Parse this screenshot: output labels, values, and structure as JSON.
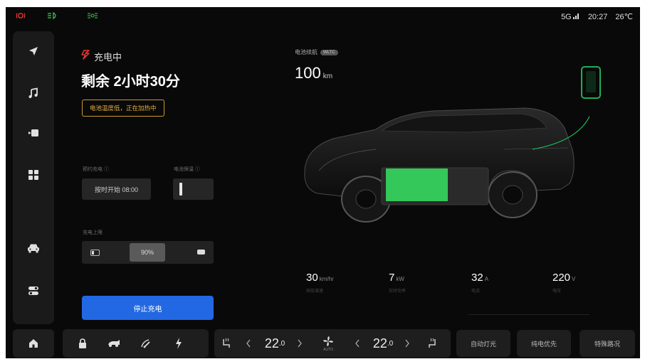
{
  "status_bar": {
    "network": "5G",
    "time": "20:27",
    "temperature": "26℃"
  },
  "sidebar": {
    "items": [
      {
        "icon": "navigation-icon"
      },
      {
        "icon": "music-icon"
      },
      {
        "icon": "camera-icon"
      },
      {
        "icon": "apps-grid-icon"
      },
      {
        "icon": "car-icon"
      },
      {
        "icon": "settings-toggle-icon"
      }
    ]
  },
  "charging": {
    "status": "充电中",
    "remaining": "剩余 2小时30分",
    "warning": "电池温度低，正在加热中",
    "schedule_label": "预约充电 ⓘ",
    "schedule_button": "按时开始 08:00",
    "keepwarm_label": "电池保温 ⓘ",
    "limit_label": "充电上限",
    "limit_value": "90%",
    "stop_button": "停止充电"
  },
  "range": {
    "label": "电池续航",
    "tag": "WLTC",
    "value": "100",
    "unit": "km"
  },
  "stats": [
    {
      "value": "30",
      "unit": "km/hr",
      "sub": "续航增速"
    },
    {
      "value": "7",
      "unit": "kW",
      "sub": "实时功率"
    },
    {
      "value": "32",
      "unit": "A",
      "sub": "电流"
    },
    {
      "value": "220",
      "unit": "V",
      "sub": "电压"
    }
  ],
  "dock": {
    "temp_left": "22",
    "temp_left_decimal": ".0",
    "temp_right": "22",
    "temp_right_decimal": ".0",
    "fan_label": "AUTO",
    "auto_lights": "自动灯光",
    "ev_priority": "纯电优先",
    "special_road": "特殊路况"
  },
  "colors": {
    "accent_blue": "#2268e3",
    "battery_green": "#34c759",
    "warning_amber": "#e7b341",
    "charging_red": "#e53935"
  }
}
